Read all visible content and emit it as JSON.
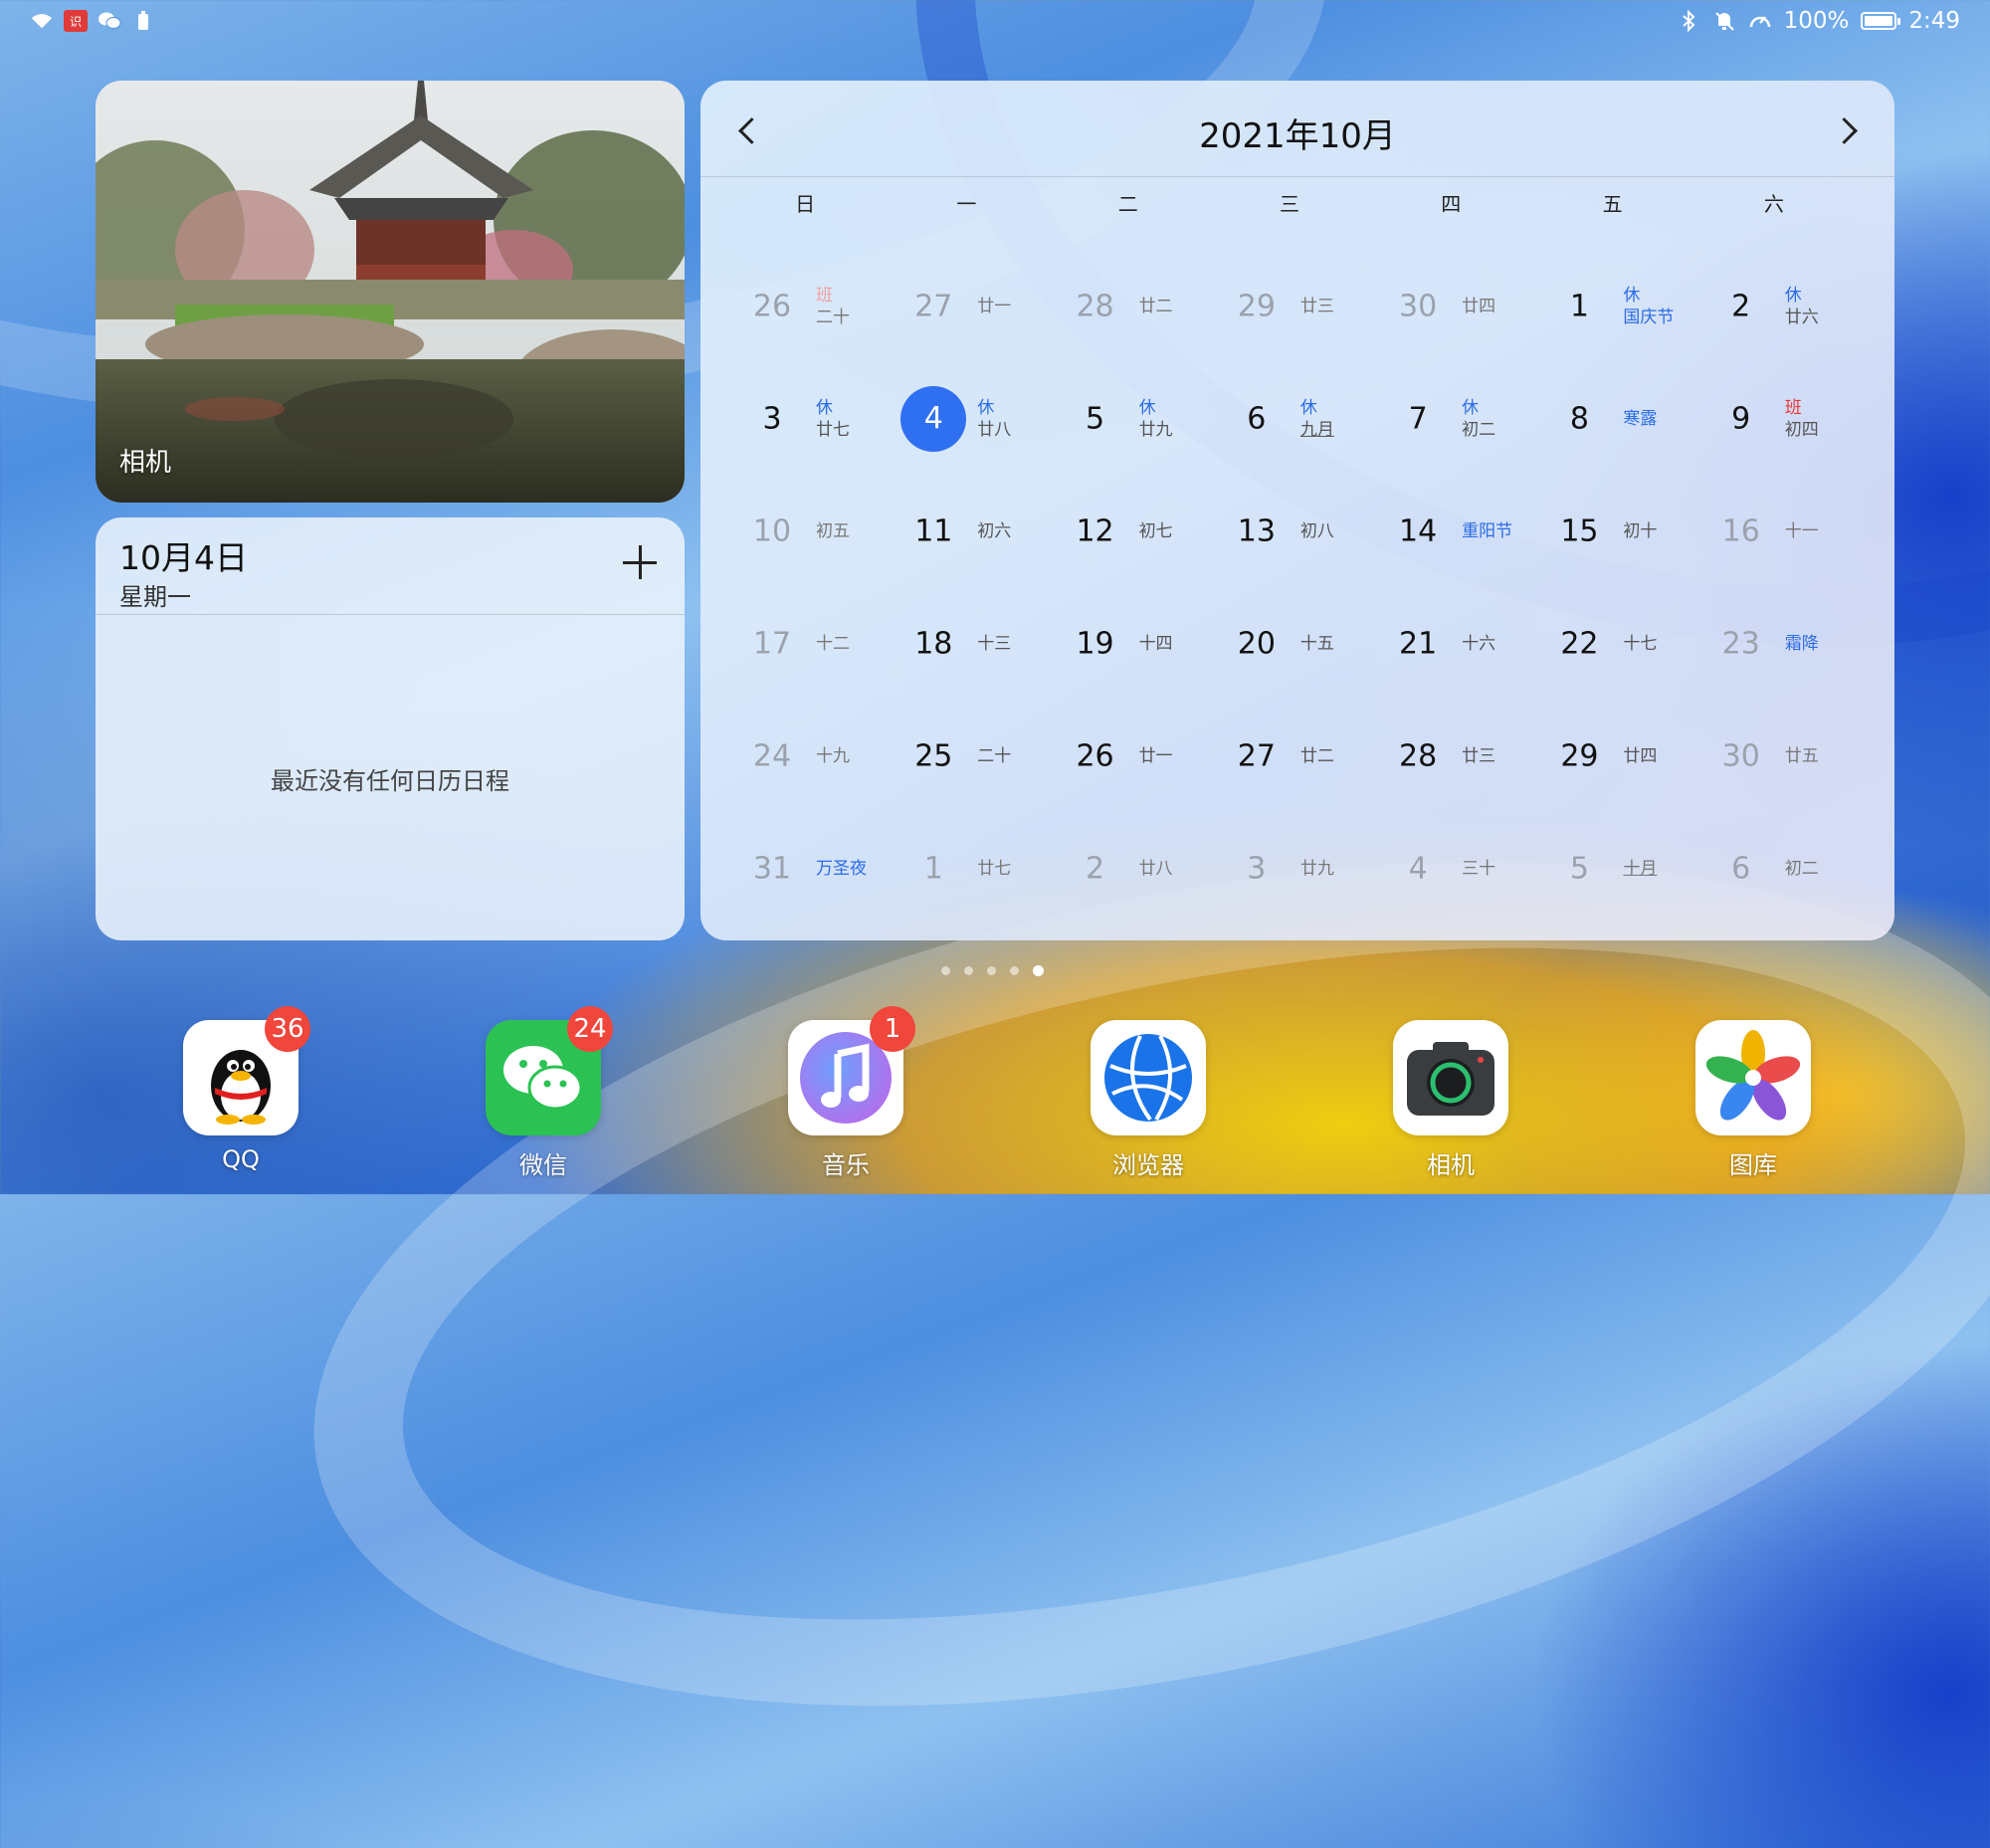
{
  "status_bar": {
    "left_icons": [
      "wifi-icon",
      "news-app-icon",
      "wechat-notification-icon",
      "battery-saver-icon"
    ],
    "right_icons": [
      "bluetooth-icon",
      "mute-icon",
      "speed-icon"
    ],
    "news_icon_text": "识",
    "battery_percent": "100%",
    "time": "2:49"
  },
  "photo_widget": {
    "label": "相机"
  },
  "schedule_widget": {
    "date": "10月4日",
    "weekday": "星期一",
    "add_icon": "plus-icon",
    "empty_text": "最近没有任何日历日程"
  },
  "calendar": {
    "title": "2021年10月",
    "prev_icon": "chevron-left-icon",
    "next_icon": "chevron-right-icon",
    "weekdays": [
      "日",
      "一",
      "二",
      "三",
      "四",
      "五",
      "六"
    ],
    "days": [
      {
        "day": "26",
        "lunar": "二十",
        "badge": "班",
        "other": true
      },
      {
        "day": "27",
        "lunar": "廿一",
        "other": true
      },
      {
        "day": "28",
        "lunar": "廿二",
        "other": true
      },
      {
        "day": "29",
        "lunar": "廿三",
        "other": true
      },
      {
        "day": "30",
        "lunar": "廿四",
        "other": true
      },
      {
        "day": "1",
        "lunar": "国庆节",
        "badge": "休",
        "festival": true
      },
      {
        "day": "2",
        "lunar": "廿六",
        "badge": "休"
      },
      {
        "day": "3",
        "lunar": "廿七",
        "badge": "休"
      },
      {
        "day": "4",
        "lunar": "廿八",
        "badge": "休",
        "today": true
      },
      {
        "day": "5",
        "lunar": "廿九",
        "badge": "休"
      },
      {
        "day": "6",
        "lunar": "九月",
        "badge": "休",
        "underline": true
      },
      {
        "day": "7",
        "lunar": "初二",
        "badge": "休"
      },
      {
        "day": "8",
        "lunar": "寒露",
        "festival": true
      },
      {
        "day": "9",
        "lunar": "初四",
        "badge": "班"
      },
      {
        "day": "10",
        "lunar": "初五",
        "other": true
      },
      {
        "day": "11",
        "lunar": "初六"
      },
      {
        "day": "12",
        "lunar": "初七"
      },
      {
        "day": "13",
        "lunar": "初八"
      },
      {
        "day": "14",
        "lunar": "重阳节",
        "festival": true
      },
      {
        "day": "15",
        "lunar": "初十"
      },
      {
        "day": "16",
        "lunar": "十一",
        "other": true
      },
      {
        "day": "17",
        "lunar": "十二",
        "other": true
      },
      {
        "day": "18",
        "lunar": "十三"
      },
      {
        "day": "19",
        "lunar": "十四"
      },
      {
        "day": "20",
        "lunar": "十五"
      },
      {
        "day": "21",
        "lunar": "十六"
      },
      {
        "day": "22",
        "lunar": "十七"
      },
      {
        "day": "23",
        "lunar": "霜降",
        "festival": true,
        "other": true
      },
      {
        "day": "24",
        "lunar": "十九",
        "other": true
      },
      {
        "day": "25",
        "lunar": "二十"
      },
      {
        "day": "26",
        "lunar": "廿一"
      },
      {
        "day": "27",
        "lunar": "廿二"
      },
      {
        "day": "28",
        "lunar": "廿三"
      },
      {
        "day": "29",
        "lunar": "廿四"
      },
      {
        "day": "30",
        "lunar": "廿五",
        "other": true
      },
      {
        "day": "31",
        "lunar": "万圣夜",
        "festival": true,
        "other": true
      },
      {
        "day": "1",
        "lunar": "廿七",
        "other": true
      },
      {
        "day": "2",
        "lunar": "廿八",
        "other": true
      },
      {
        "day": "3",
        "lunar": "廿九",
        "other": true
      },
      {
        "day": "4",
        "lunar": "三十",
        "other": true
      },
      {
        "day": "5",
        "lunar": "十月",
        "underline": true,
        "other": true
      },
      {
        "day": "6",
        "lunar": "初二",
        "other": true
      }
    ]
  },
  "page_indicator": {
    "total": 5,
    "active": 5
  },
  "dock": [
    {
      "label": "QQ",
      "badge": "36",
      "icon": "qq-penguin-icon",
      "color": "#ffffff"
    },
    {
      "label": "微信",
      "badge": "24",
      "icon": "wechat-icon",
      "color": "#2bc253"
    },
    {
      "label": "音乐",
      "badge": "1",
      "icon": "music-note-icon",
      "color": "#ffffff"
    },
    {
      "label": "浏览器",
      "badge": "",
      "icon": "browser-globe-icon",
      "color": "#ffffff"
    },
    {
      "label": "相机",
      "badge": "",
      "icon": "camera-icon",
      "color": "#ffffff"
    },
    {
      "label": "图库",
      "badge": "",
      "icon": "gallery-pinwheel-icon",
      "color": "#ffffff"
    }
  ]
}
